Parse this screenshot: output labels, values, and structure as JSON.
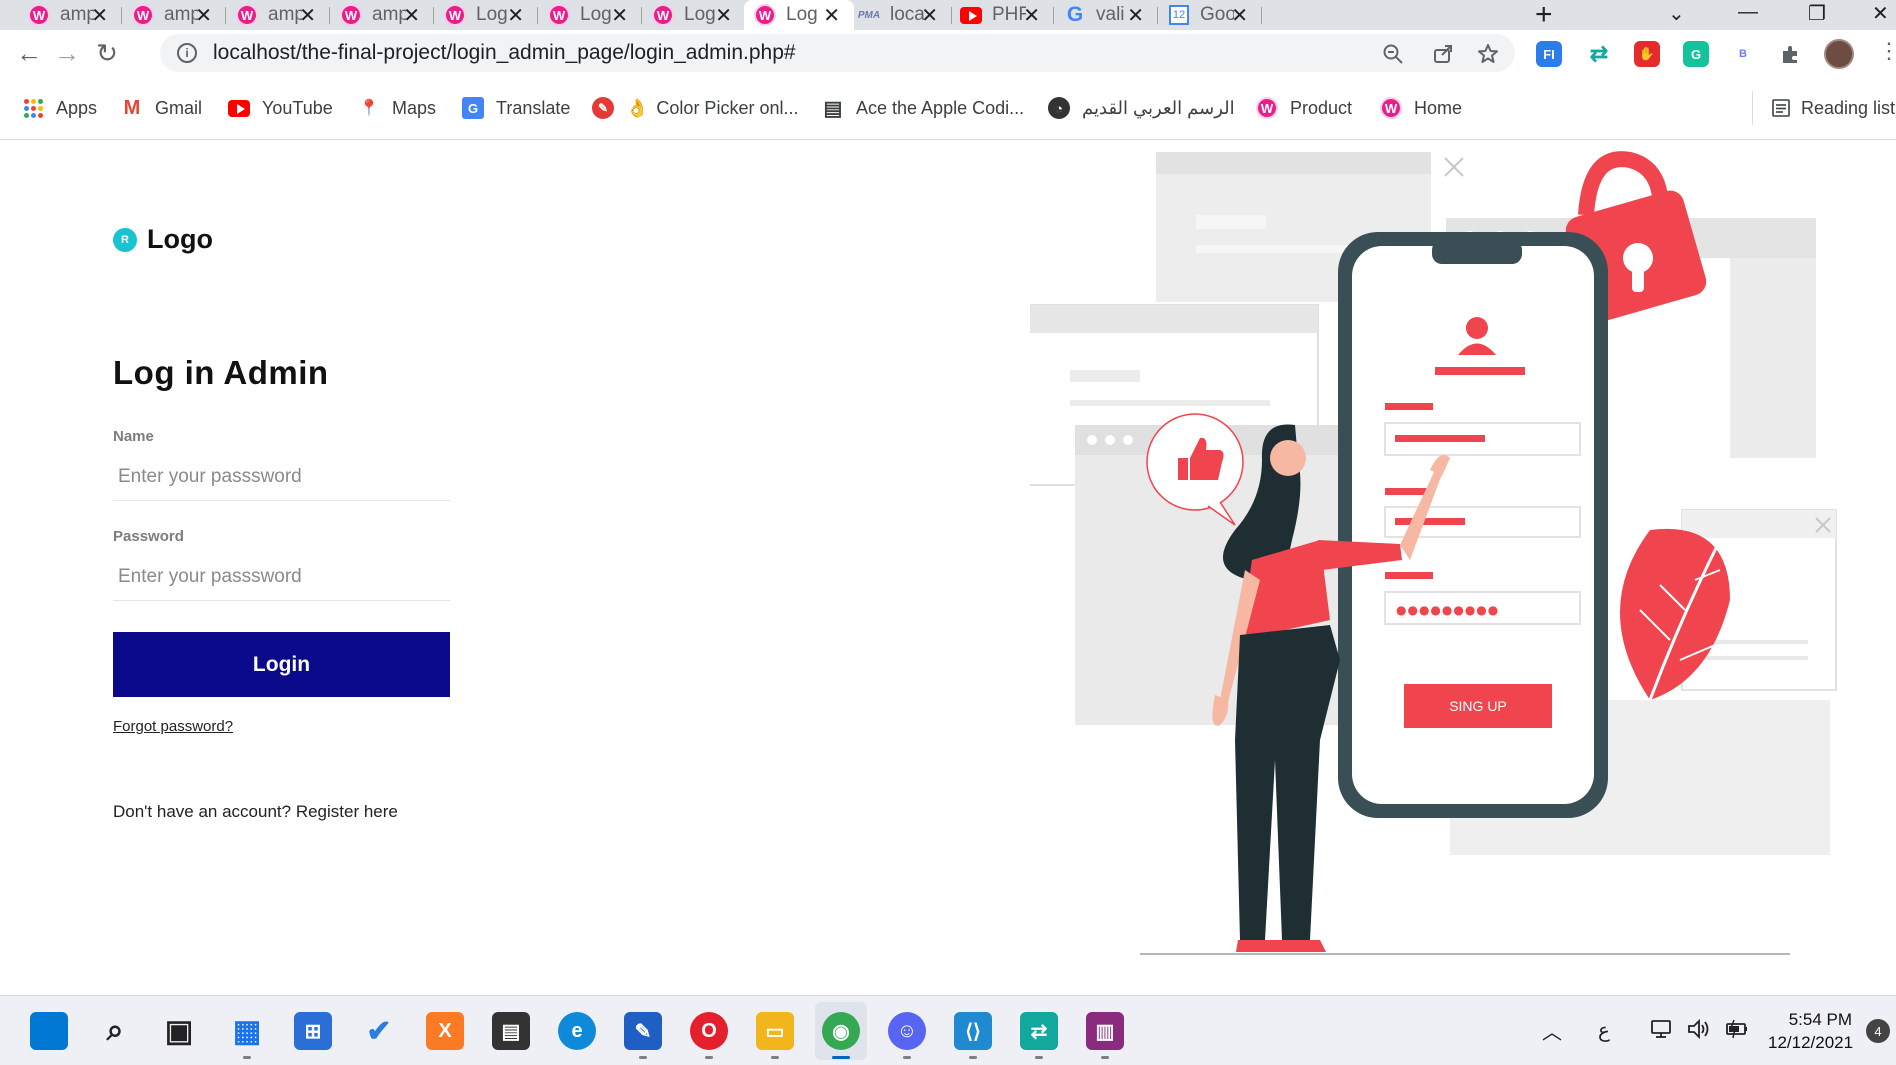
{
  "browser": {
    "tabs": [
      {
        "title": "ampps",
        "icon": "wamp-icon",
        "active": false
      },
      {
        "title": "ampps",
        "icon": "wamp-icon",
        "active": false
      },
      {
        "title": "ampps",
        "icon": "wamp-icon",
        "active": false
      },
      {
        "title": "ampps",
        "icon": "wamp-icon",
        "active": false
      },
      {
        "title": "Log",
        "icon": "wamp-icon",
        "active": false
      },
      {
        "title": "Log",
        "icon": "wamp-icon",
        "active": false
      },
      {
        "title": "Log",
        "icon": "wamp-icon",
        "active": false
      },
      {
        "title": "Log",
        "icon": "wamp-icon",
        "active": true
      },
      {
        "title": "loca",
        "icon": "phpmyadmin-icon",
        "active": false
      },
      {
        "title": "PHF",
        "icon": "youtube-icon",
        "active": false
      },
      {
        "title": "vali",
        "icon": "google-icon",
        "active": false
      },
      {
        "title": "Goo",
        "icon": "calendar-icon",
        "active": false
      }
    ],
    "pma_label": "PMA",
    "calendar_day": "12",
    "google_letter": "G",
    "url": "localhost/the-final-project/login_admin_page/login_admin.php#",
    "info_icon_glyph": "i",
    "bookmarks": [
      {
        "label": "Apps",
        "icon": "apps-icon"
      },
      {
        "label": "Gmail",
        "icon": "gmail-icon"
      },
      {
        "label": "YouTube",
        "icon": "youtube-icon"
      },
      {
        "label": "Maps",
        "icon": "maps-icon"
      },
      {
        "label": "Translate",
        "icon": "translate-icon"
      },
      {
        "label": "Color Picker onl...",
        "icon": "color-picker-icon"
      },
      {
        "label": "Ace the Apple Codi...",
        "icon": "document-icon"
      },
      {
        "label": "الرسم العربي القديم",
        "icon": "circle-icon"
      },
      {
        "label": "Product",
        "icon": "wamp-icon"
      },
      {
        "label": "Home",
        "icon": "wamp-icon"
      }
    ],
    "reading_list": "Reading list",
    "extensions": [
      {
        "name": "fi-extension-icon",
        "glyph": "FI",
        "color": "#2b7de9"
      },
      {
        "name": "screen-share-extension-icon",
        "glyph": "⇄",
        "color": "#13a89e"
      },
      {
        "name": "stop-extension-icon",
        "glyph": "✋",
        "color": "#e52b2b"
      },
      {
        "name": "grammarly-extension-icon",
        "glyph": "G",
        "color": "#15c39a"
      },
      {
        "name": "b-extension-icon",
        "glyph": "B",
        "color": "#6b7cff"
      }
    ]
  },
  "page": {
    "brand_badge": "R",
    "brand": "Logo",
    "heading": "Log in Admin",
    "name_label": "Name",
    "name_placeholder": "Enter your passsword",
    "password_label": "Password",
    "password_placeholder": "Enter your passsword",
    "login_button": "Login",
    "forgot_link": "Forgot password?",
    "register_text": "Don't have an account? Register here",
    "illustration": {
      "signup_button": "SING UP",
      "password_mask": "●●●●●●●●●",
      "accent_color": "#f0454f"
    }
  },
  "taskbar": {
    "apps": [
      {
        "name": "windows-start-icon",
        "glyph": "",
        "color": "#0078d4"
      },
      {
        "name": "search-icon",
        "glyph": "⌕",
        "color": "#222222"
      },
      {
        "name": "task-view-icon",
        "glyph": "▣",
        "color": "#222222"
      },
      {
        "name": "widgets-icon",
        "glyph": "▦",
        "color": "#1a73e8"
      },
      {
        "name": "microsoft-store-icon",
        "glyph": "⊞",
        "color": "#2b6fd6"
      },
      {
        "name": "todo-icon",
        "glyph": "✔",
        "color": "#2a7de1"
      },
      {
        "name": "xampp-icon",
        "glyph": "X",
        "color": "#fb7a24"
      },
      {
        "name": "sticky-notes-icon",
        "glyph": "▤",
        "color": "#333333"
      },
      {
        "name": "edge-icon",
        "glyph": "e",
        "color": "#0f8ad9"
      },
      {
        "name": "whiteboard-icon",
        "glyph": "✎",
        "color": "#1f5fc4"
      },
      {
        "name": "opera-icon",
        "glyph": "O",
        "color": "#e5202e"
      },
      {
        "name": "file-explorer-icon",
        "glyph": "▭",
        "color": "#f2b51c"
      },
      {
        "name": "chrome-icon",
        "glyph": "◉",
        "color": "#34a853"
      },
      {
        "name": "discord-icon",
        "glyph": "☺",
        "color": "#5865f2"
      },
      {
        "name": "vscode-icon",
        "glyph": "⟨⟩",
        "color": "#1f8ad2"
      },
      {
        "name": "screen-share-icon",
        "glyph": "⇄",
        "color": "#13a89e"
      },
      {
        "name": "winrar-icon",
        "glyph": "▥",
        "color": "#8b2b7d"
      }
    ],
    "active_app": "chrome-icon",
    "language": "ع",
    "time": "5:54 PM",
    "date": "12/12/2021",
    "notifications": "4"
  }
}
